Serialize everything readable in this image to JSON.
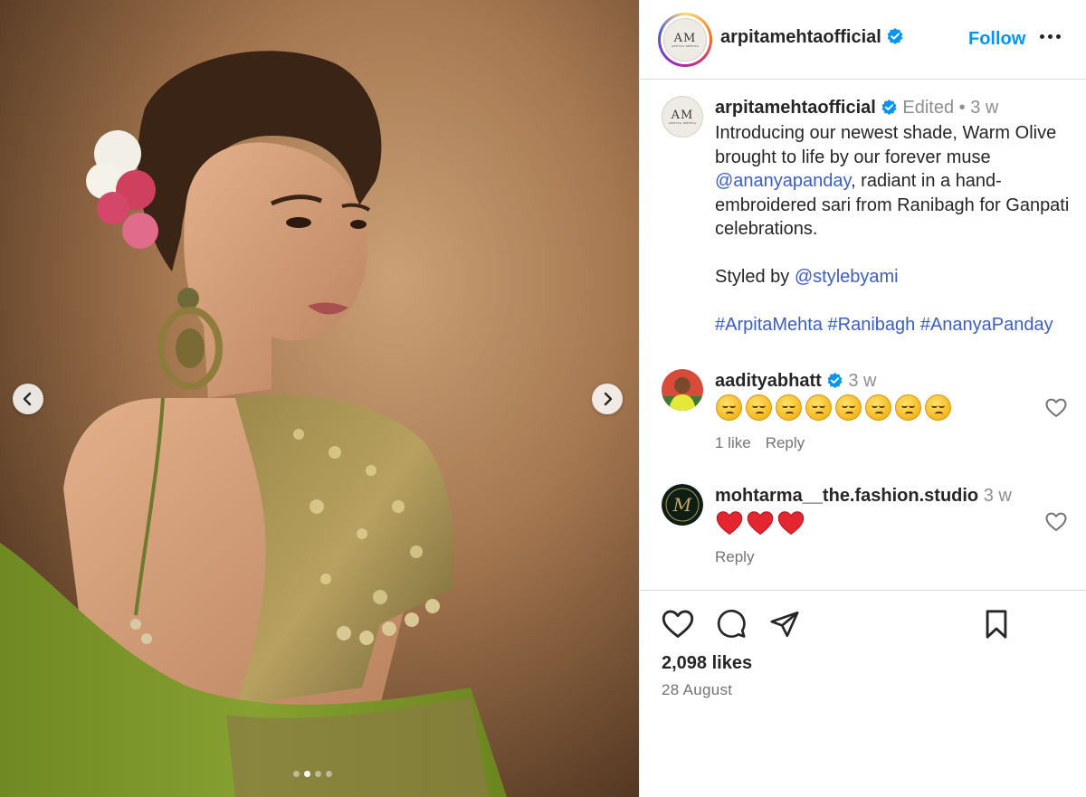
{
  "post": {
    "account": "arpitamehtaofficial",
    "logo": {
      "monogram": "AM",
      "subtext": "ARPITA MEHTA"
    },
    "follow_label": "Follow",
    "caption": {
      "username": "arpitamehtaofficial",
      "edited": "Edited",
      "separator": "•",
      "time": "3 w",
      "text_1": "Introducing our newest shade, Warm Olive brought to life by our forever muse ",
      "mention_1": "@ananyapanday",
      "text_2": ", radiant in a hand-embroidered sari from Ranibagh for Ganpati celebrations.",
      "styled_by": "Styled by ",
      "mention_2": "@stylebyami",
      "hashtags": [
        "#ArpitaMehta",
        "#Ranibagh",
        "#AnanyaPanday"
      ]
    },
    "comments": [
      {
        "username": "aadityabhatt",
        "verified": true,
        "time": "3 w",
        "emoji": "pensive-face",
        "emoji_count": 8,
        "likes": "1 like",
        "reply": "Reply"
      },
      {
        "username": "mohtarma__the.fashion.studio",
        "verified": false,
        "time": "3 w",
        "emoji": "red-heart",
        "emoji_count": 3,
        "reply": "Reply",
        "avatar_monogram": "M"
      }
    ],
    "likes": "2,098 likes",
    "date": "28 August",
    "carousel": {
      "total": 4,
      "active": 2
    }
  },
  "colors": {
    "accent": "#0095f6",
    "link": "#3b5dc9",
    "verified": "#0095f6",
    "sari": "#7f9a2b"
  },
  "icons": [
    "chevron-left-icon",
    "chevron-right-icon",
    "verified-badge-icon",
    "more-options-icon",
    "heart-icon",
    "comment-icon",
    "share-icon",
    "bookmark-icon"
  ]
}
